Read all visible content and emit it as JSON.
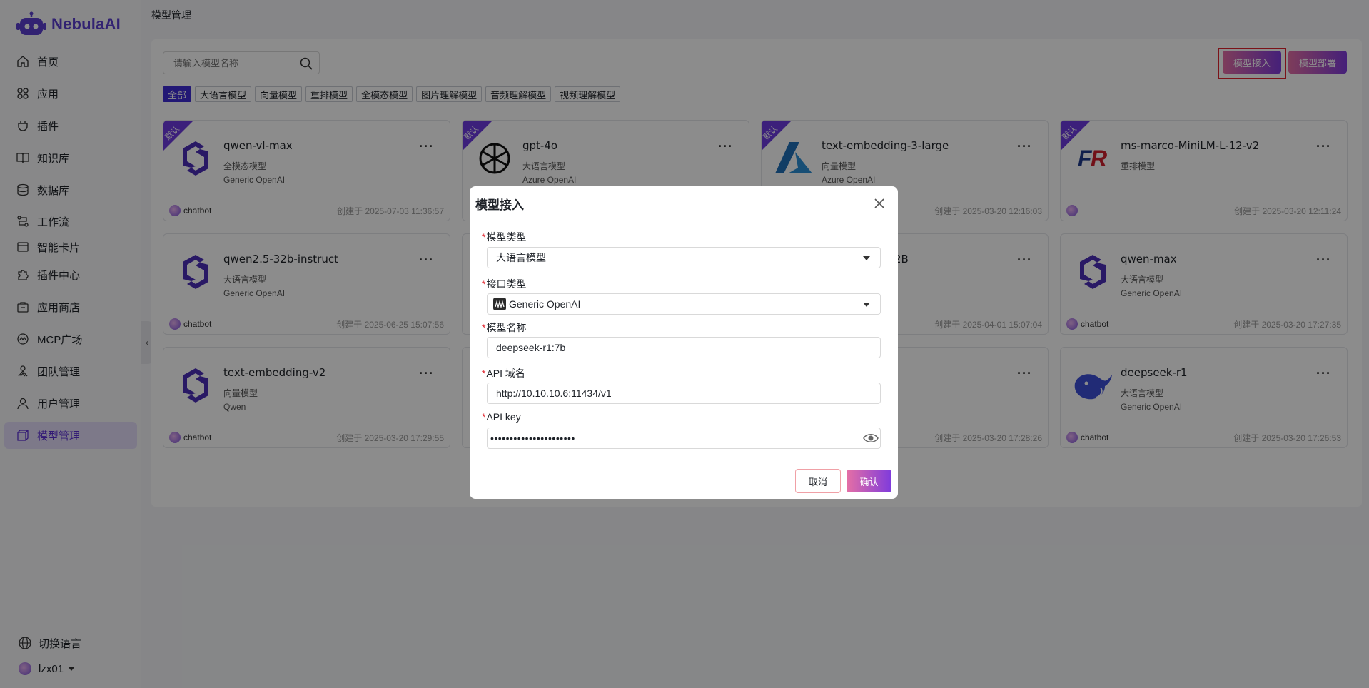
{
  "app": {
    "name": "NebulaAI"
  },
  "sidebar": {
    "items": [
      {
        "label": "首页",
        "icon": "home-icon"
      },
      {
        "label": "应用",
        "icon": "apps-icon"
      },
      {
        "label": "插件",
        "icon": "plugin-icon"
      },
      {
        "label": "知识库",
        "icon": "book-icon"
      },
      {
        "label": "数据库",
        "icon": "database-icon"
      },
      {
        "label": "工作流",
        "icon": "workflow-icon"
      },
      {
        "label": "智能卡片",
        "icon": "card-icon"
      },
      {
        "label": "插件中心",
        "icon": "puzzle-icon"
      },
      {
        "label": "应用商店",
        "icon": "store-icon"
      },
      {
        "label": "MCP广场",
        "icon": "mcp-icon"
      },
      {
        "label": "团队管理",
        "icon": "team-icon"
      },
      {
        "label": "用户管理",
        "icon": "user-icon"
      },
      {
        "label": "模型管理",
        "icon": "cube-icon",
        "active": true
      }
    ],
    "language_label": "切换语言",
    "username": "lzx01"
  },
  "header": {
    "breadcrumb": "模型管理"
  },
  "toolbar": {
    "search_placeholder": "请输入模型名称",
    "add_label": "模型接入",
    "deploy_label": "模型部署"
  },
  "filters": [
    "全部",
    "大语言模型",
    "向量模型",
    "重排模型",
    "全模态模型",
    "图片理解模型",
    "音频理解模型",
    "视频理解模型"
  ],
  "cards": [
    {
      "name": "qwen-vl-max",
      "type": "全模态模型",
      "provider": "Generic OpenAI",
      "owner": "chatbot",
      "date": "创建于 2025-07-03 11:36:57",
      "default_badge": "默认"
    },
    {
      "name": "gpt-4o",
      "type": "大语言模型",
      "provider": "Azure OpenAI",
      "owner": "",
      "date": "",
      "default_badge": "默认"
    },
    {
      "name": "text-embedding-3-large",
      "type": "向量模型",
      "provider": "Azure OpenAI",
      "owner": "",
      "date": "创建于 2025-03-20 12:16:03",
      "default_badge": "默认"
    },
    {
      "name": "ms-marco-MiniLM-L-12-v2",
      "type": "重排模型",
      "provider": "",
      "owner": "",
      "date": "创建于 2025-03-20 12:11:24",
      "default_badge": "默认"
    },
    {
      "name": "qwen2.5-32b-instruct",
      "type": "大语言模型",
      "provider": "Generic OpenAI",
      "owner": "chatbot",
      "date": "创建于 2025-06-25 15:07:56"
    },
    {
      "name": "2B",
      "type": "",
      "provider": "",
      "owner": "",
      "date": "创建于 2025-04-01 15:07:04"
    },
    {
      "name": "qwen-max",
      "type": "大语言模型",
      "provider": "Generic OpenAI",
      "owner": "chatbot",
      "date": "创建于 2025-03-20 17:27:35"
    },
    {
      "name": "text-embedding-v2",
      "type": "向量模型",
      "provider": "Qwen",
      "owner": "chatbot",
      "date": "创建于 2025-03-20 17:29:55"
    },
    {
      "name": "",
      "type": "",
      "provider": "",
      "owner": "",
      "date": "创建于 2025-03-20 17:28:26"
    },
    {
      "name": "deepseek-r1",
      "type": "大语言模型",
      "provider": "Generic OpenAI",
      "owner": "chatbot",
      "date": "创建于 2025-03-20 17:26:53"
    }
  ],
  "modal": {
    "title": "模型接入",
    "fields": {
      "model_type": {
        "label": "模型类型",
        "value": "大语言模型"
      },
      "api_type": {
        "label": "接口类型",
        "value": "Generic OpenAI"
      },
      "model_name": {
        "label": "模型名称",
        "value": "deepseek-r1:7b"
      },
      "api_domain": {
        "label": "API 域名",
        "value": "http://10.10.10.6:11434/v1"
      },
      "api_key": {
        "label": "API key",
        "value": "••••••••••••••••••••••"
      }
    },
    "cancel_label": "取消",
    "confirm_label": "确认"
  },
  "colors": {
    "accent": "#5b2fd6",
    "gradient_start": "#e56fa5",
    "gradient_end": "#7f3bdc",
    "highlight_box": "#e0222c"
  }
}
